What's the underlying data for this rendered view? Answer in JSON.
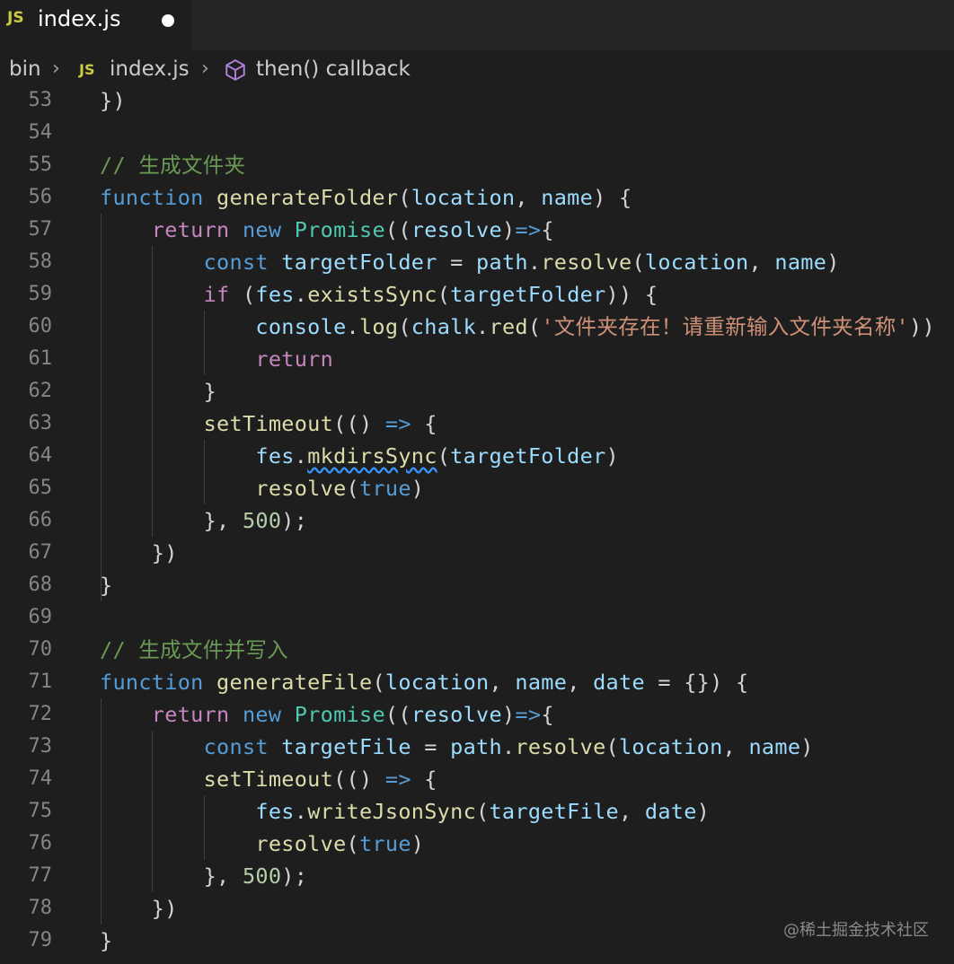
{
  "tab": {
    "icon": "JS",
    "label": "index.js"
  },
  "breadcrumb": {
    "folder": "bin",
    "file_icon": "JS",
    "file": "index.js",
    "symbol": "then() callback"
  },
  "lines": [
    {
      "n": "53",
      "t": [
        [
          "pun",
          "})"
        ]
      ]
    },
    {
      "n": "54",
      "t": []
    },
    {
      "n": "55",
      "t": [
        [
          "cmt",
          "// 生成文件夹"
        ]
      ]
    },
    {
      "n": "56",
      "t": [
        [
          "kw",
          "function"
        ],
        [
          "pun",
          " "
        ],
        [
          "fn",
          "generateFolder"
        ],
        [
          "pun",
          "("
        ],
        [
          "var",
          "location"
        ],
        [
          "pun",
          ", "
        ],
        [
          "var",
          "name"
        ],
        [
          "pun",
          ") {"
        ]
      ]
    },
    {
      "n": "57",
      "t": [
        [
          "pun",
          "    "
        ],
        [
          "ctl",
          "return"
        ],
        [
          "pun",
          " "
        ],
        [
          "kw",
          "new"
        ],
        [
          "pun",
          " "
        ],
        [
          "cls",
          "Promise"
        ],
        [
          "pun",
          "(("
        ],
        [
          "var",
          "resolve"
        ],
        [
          "pun",
          ")"
        ],
        [
          "kw",
          "=>"
        ],
        [
          "pun",
          "{"
        ]
      ]
    },
    {
      "n": "58",
      "t": [
        [
          "pun",
          "        "
        ],
        [
          "kw",
          "const"
        ],
        [
          "pun",
          " "
        ],
        [
          "var",
          "targetFolder"
        ],
        [
          "pun",
          " = "
        ],
        [
          "var",
          "path"
        ],
        [
          "pun",
          "."
        ],
        [
          "fn",
          "resolve"
        ],
        [
          "pun",
          "("
        ],
        [
          "var",
          "location"
        ],
        [
          "pun",
          ", "
        ],
        [
          "var",
          "name"
        ],
        [
          "pun",
          ")"
        ]
      ]
    },
    {
      "n": "59",
      "t": [
        [
          "pun",
          "        "
        ],
        [
          "ctl",
          "if"
        ],
        [
          "pun",
          " ("
        ],
        [
          "var",
          "fes"
        ],
        [
          "pun",
          "."
        ],
        [
          "fn",
          "existsSync"
        ],
        [
          "pun",
          "("
        ],
        [
          "var",
          "targetFolder"
        ],
        [
          "pun",
          ")) {"
        ]
      ]
    },
    {
      "n": "60",
      "t": [
        [
          "pun",
          "            "
        ],
        [
          "var",
          "console"
        ],
        [
          "pun",
          "."
        ],
        [
          "fn",
          "log"
        ],
        [
          "pun",
          "("
        ],
        [
          "var",
          "chalk"
        ],
        [
          "pun",
          "."
        ],
        [
          "fn",
          "red"
        ],
        [
          "pun",
          "("
        ],
        [
          "str",
          "'文件夹存在！请重新输入文件夹名称'"
        ],
        [
          "pun",
          "))"
        ]
      ]
    },
    {
      "n": "61",
      "t": [
        [
          "pun",
          "            "
        ],
        [
          "ctl",
          "return"
        ]
      ]
    },
    {
      "n": "62",
      "t": [
        [
          "pun",
          "        }"
        ]
      ]
    },
    {
      "n": "63",
      "t": [
        [
          "pun",
          "        "
        ],
        [
          "fn",
          "setTimeout"
        ],
        [
          "pun",
          "(() "
        ],
        [
          "kw",
          "=>"
        ],
        [
          "pun",
          " {"
        ]
      ]
    },
    {
      "n": "64",
      "t": [
        [
          "pun",
          "            "
        ],
        [
          "var",
          "fes"
        ],
        [
          "pun",
          "."
        ],
        [
          "fn squiggle",
          "mkdirsSync"
        ],
        [
          "pun",
          "("
        ],
        [
          "var",
          "targetFolder"
        ],
        [
          "pun",
          ")"
        ]
      ]
    },
    {
      "n": "65",
      "t": [
        [
          "pun",
          "            "
        ],
        [
          "fn",
          "resolve"
        ],
        [
          "pun",
          "("
        ],
        [
          "kw",
          "true"
        ],
        [
          "pun",
          ")"
        ]
      ]
    },
    {
      "n": "66",
      "t": [
        [
          "pun",
          "        }, "
        ],
        [
          "num",
          "500"
        ],
        [
          "pun",
          ");"
        ]
      ]
    },
    {
      "n": "67",
      "t": [
        [
          "pun",
          "    })"
        ]
      ]
    },
    {
      "n": "68",
      "t": [
        [
          "pun",
          "}"
        ]
      ]
    },
    {
      "n": "69",
      "t": []
    },
    {
      "n": "70",
      "t": [
        [
          "cmt",
          "// 生成文件并写入"
        ]
      ]
    },
    {
      "n": "71",
      "t": [
        [
          "kw",
          "function"
        ],
        [
          "pun",
          " "
        ],
        [
          "fn",
          "generateFile"
        ],
        [
          "pun",
          "("
        ],
        [
          "var",
          "location"
        ],
        [
          "pun",
          ", "
        ],
        [
          "var",
          "name"
        ],
        [
          "pun",
          ", "
        ],
        [
          "var",
          "date"
        ],
        [
          "pun",
          " = {}) {"
        ]
      ]
    },
    {
      "n": "72",
      "t": [
        [
          "pun",
          "    "
        ],
        [
          "ctl",
          "return"
        ],
        [
          "pun",
          " "
        ],
        [
          "kw",
          "new"
        ],
        [
          "pun",
          " "
        ],
        [
          "cls",
          "Promise"
        ],
        [
          "pun",
          "(("
        ],
        [
          "var",
          "resolve"
        ],
        [
          "pun",
          ")"
        ],
        [
          "kw",
          "=>"
        ],
        [
          "pun",
          "{"
        ]
      ]
    },
    {
      "n": "73",
      "t": [
        [
          "pun",
          "        "
        ],
        [
          "kw",
          "const"
        ],
        [
          "pun",
          " "
        ],
        [
          "var",
          "targetFile"
        ],
        [
          "pun",
          " = "
        ],
        [
          "var",
          "path"
        ],
        [
          "pun",
          "."
        ],
        [
          "fn",
          "resolve"
        ],
        [
          "pun",
          "("
        ],
        [
          "var",
          "location"
        ],
        [
          "pun",
          ", "
        ],
        [
          "var",
          "name"
        ],
        [
          "pun",
          ")"
        ]
      ]
    },
    {
      "n": "74",
      "t": [
        [
          "pun",
          "        "
        ],
        [
          "fn",
          "setTimeout"
        ],
        [
          "pun",
          "(() "
        ],
        [
          "kw",
          "=>"
        ],
        [
          "pun",
          " {"
        ]
      ]
    },
    {
      "n": "75",
      "t": [
        [
          "pun",
          "            "
        ],
        [
          "var",
          "fes"
        ],
        [
          "pun",
          "."
        ],
        [
          "fn",
          "writeJsonSync"
        ],
        [
          "pun",
          "("
        ],
        [
          "var",
          "targetFile"
        ],
        [
          "pun",
          ", "
        ],
        [
          "var",
          "date"
        ],
        [
          "pun",
          ")"
        ]
      ]
    },
    {
      "n": "76",
      "t": [
        [
          "pun",
          "            "
        ],
        [
          "fn",
          "resolve"
        ],
        [
          "pun",
          "("
        ],
        [
          "kw",
          "true"
        ],
        [
          "pun",
          ")"
        ]
      ]
    },
    {
      "n": "77",
      "t": [
        [
          "pun",
          "        }, "
        ],
        [
          "num",
          "500"
        ],
        [
          "pun",
          ");"
        ]
      ]
    },
    {
      "n": "78",
      "t": [
        [
          "pun",
          "    })"
        ]
      ]
    },
    {
      "n": "79",
      "t": [
        [
          "pun",
          "}"
        ]
      ]
    }
  ],
  "watermark": "@稀土掘金技术社区",
  "colors": {
    "background": "#1e1e1e",
    "keyword": "#569cd6",
    "control": "#c586c0",
    "function": "#dcdcaa",
    "variable": "#9cdcfe",
    "class": "#4ec9b0",
    "string": "#ce9178",
    "number": "#b5cea8",
    "comment": "#6a9955"
  }
}
